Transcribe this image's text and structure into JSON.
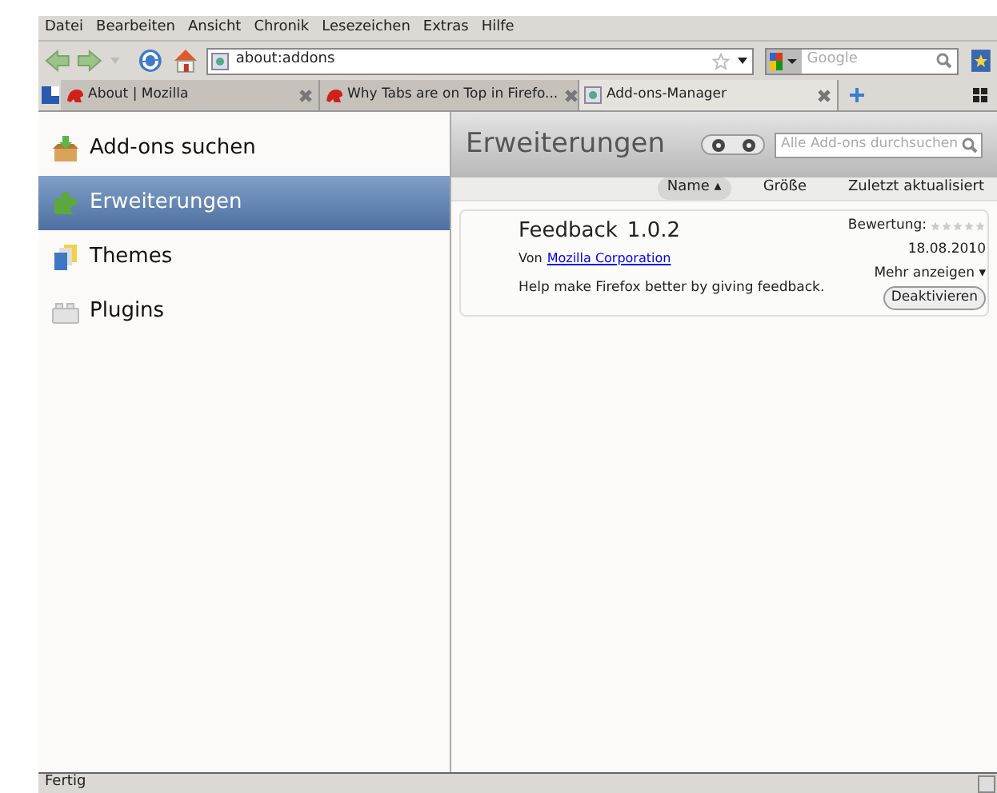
{
  "menu": [
    "Datei",
    "Bearbeiten",
    "Ansicht",
    "Chronik",
    "Lesezeichen",
    "Extras",
    "Hilfe"
  ],
  "address": {
    "value": "about:addons"
  },
  "search": {
    "placeholder": "Google"
  },
  "tabs": [
    {
      "label": "About | Mozilla",
      "selected": false,
      "kind": "web"
    },
    {
      "label": "Why Tabs are on Top in Firefo...",
      "selected": false,
      "kind": "web"
    },
    {
      "label": "Add-ons-Manager",
      "selected": true,
      "kind": "addons"
    }
  ],
  "sidebar": {
    "items": [
      {
        "label": "Add-ons suchen",
        "selected": false,
        "kind": "get"
      },
      {
        "label": "Erweiterungen",
        "selected": true,
        "kind": "extensions"
      },
      {
        "label": "Themes",
        "selected": false,
        "kind": "themes"
      },
      {
        "label": "Plugins",
        "selected": false,
        "kind": "plugins"
      }
    ]
  },
  "header": {
    "title": "Erweiterungen",
    "search_placeholder": "Alle Add-ons durchsuchen"
  },
  "sort": [
    {
      "label": "Name ▴",
      "selected": true
    },
    {
      "label": "Größe",
      "selected": false
    },
    {
      "label": "Zuletzt aktualisiert",
      "selected": false
    }
  ],
  "addons": [
    {
      "name": "Feedback",
      "version": "1.0.2",
      "by": "Von",
      "author": "Mozilla Corporation",
      "description": "Help make Firefox better by giving feedback.",
      "rating_label": "Bewertung:",
      "stars": 0,
      "date": "18.08.2010",
      "more": "Mehr anzeigen ▾",
      "button": "Deaktivieren"
    }
  ],
  "status_bar": {
    "text": "Fertig"
  }
}
